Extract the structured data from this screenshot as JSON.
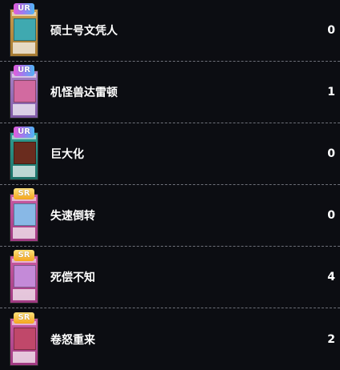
{
  "cards": [
    {
      "rarity": "UR",
      "name": "硕士号文凭人",
      "count": "0",
      "card_frame": "monster",
      "art_color": "#3fa9b0"
    },
    {
      "rarity": "UR",
      "name": "机怪兽达雷顿",
      "count": "1",
      "card_frame": "fusion",
      "art_color": "#d26aa0"
    },
    {
      "rarity": "UR",
      "name": "巨大化",
      "count": "0",
      "card_frame": "spell",
      "art_color": "#6a2c1e"
    },
    {
      "rarity": "SR",
      "name": "失速倒转",
      "count": "0",
      "card_frame": "trap",
      "art_color": "#88b8e6"
    },
    {
      "rarity": "SR",
      "name": "死偿不知",
      "count": "4",
      "card_frame": "trap",
      "art_color": "#c48ad8"
    },
    {
      "rarity": "SR",
      "name": "卷怒重来",
      "count": "2",
      "card_frame": "trap",
      "art_color": "#c0486a"
    }
  ],
  "colors": {
    "background": "#0c0d12",
    "divider": "#6d6f78",
    "ur_badge": "#9f7bf0",
    "sr_badge": "#f3a51d"
  }
}
